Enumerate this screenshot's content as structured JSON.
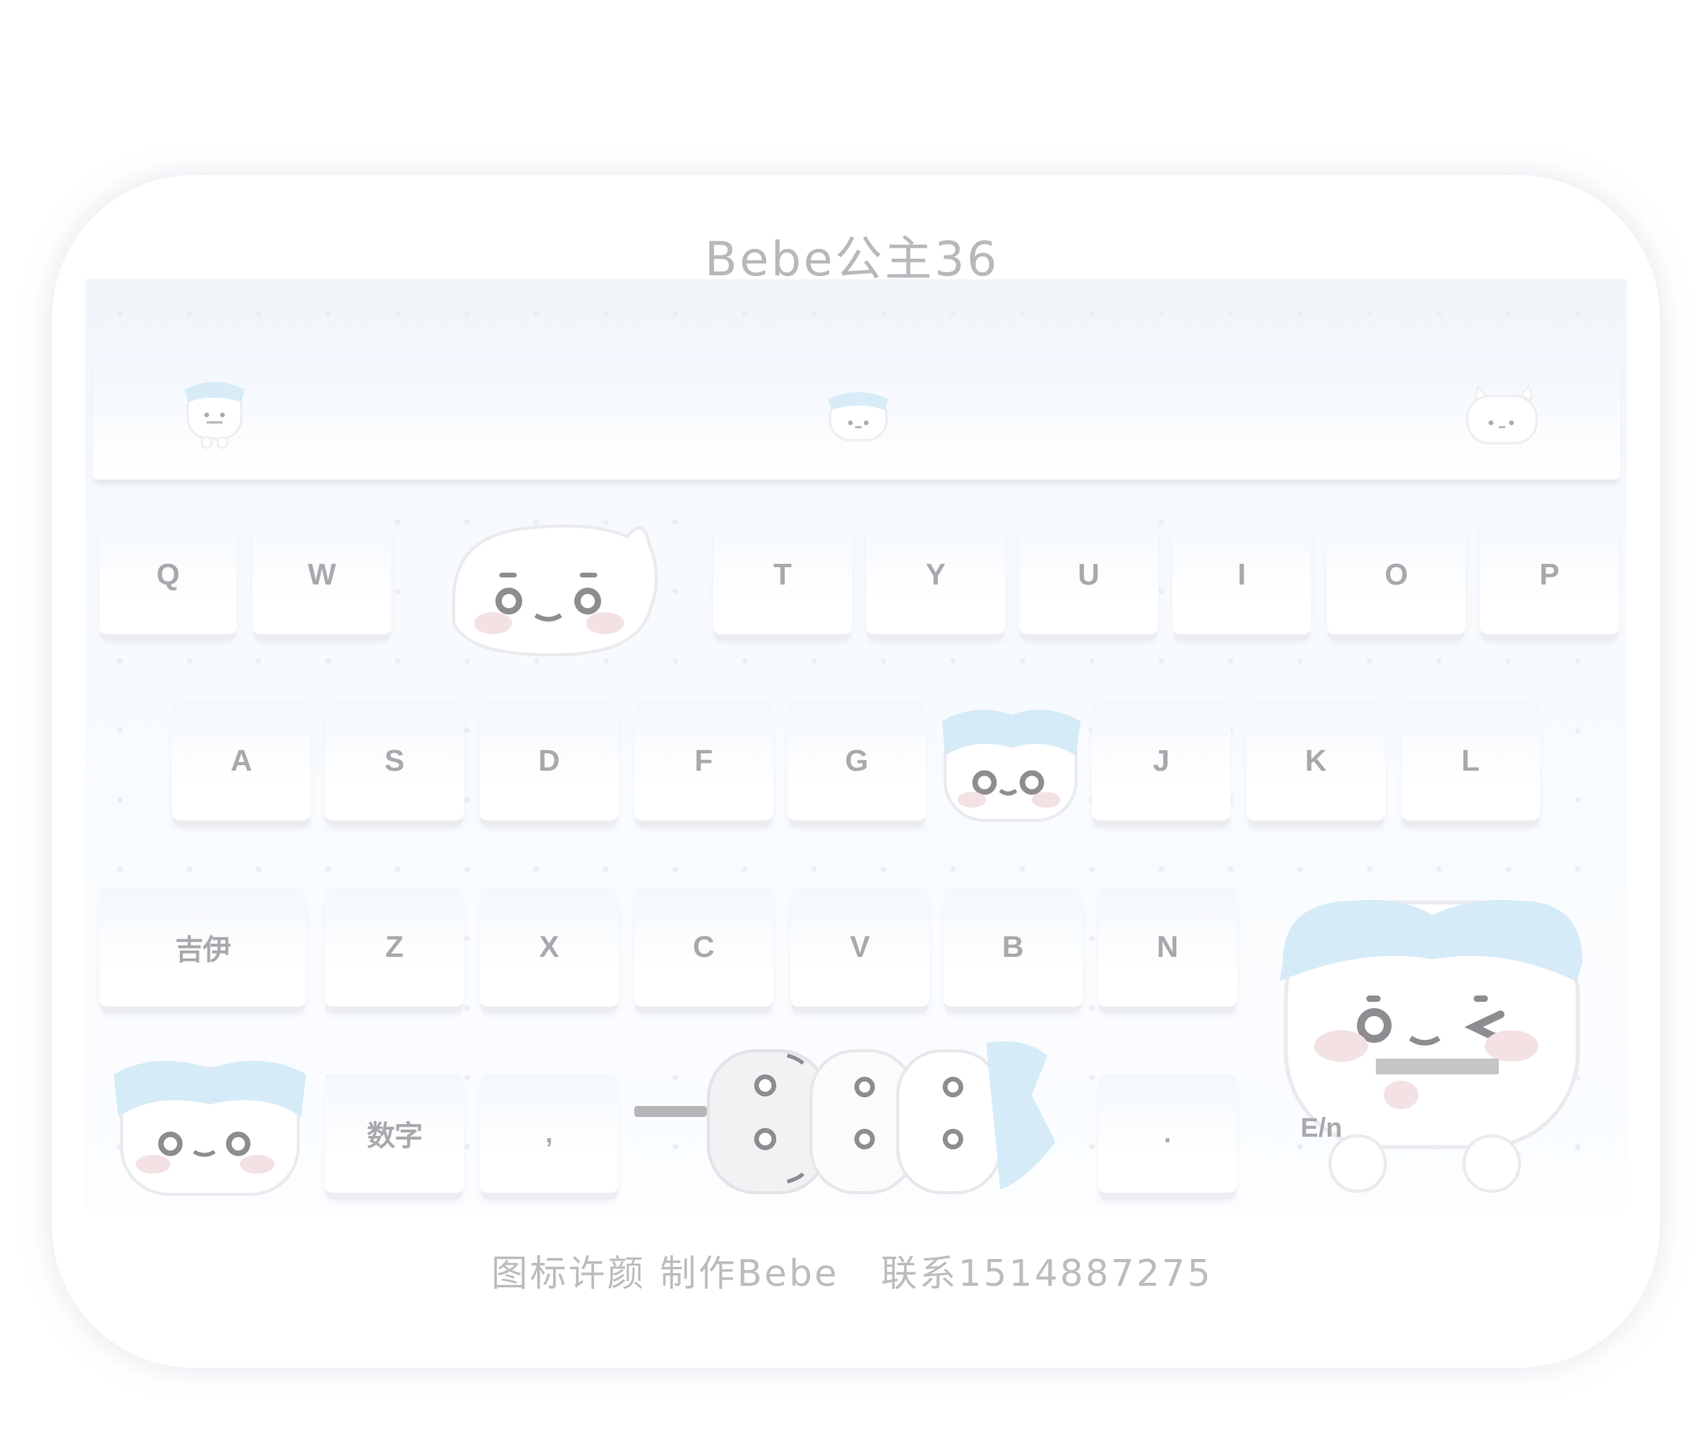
{
  "title": "Bebe公主36",
  "footer": "图标许颜 制作Bebe   联系1514887275",
  "keyboard": {
    "row1": [
      "Q",
      "W",
      "T",
      "Y",
      "U",
      "I",
      "O",
      "P"
    ],
    "row2": [
      "A",
      "S",
      "D",
      "F",
      "G",
      "J",
      "K",
      "L"
    ],
    "row3_special": "吉伊",
    "row3": [
      "Z",
      "X",
      "C",
      "V",
      "B",
      "N"
    ],
    "row4": {
      "numbers": "数字",
      "comma": ",",
      "period": ".",
      "lang": "E/n"
    }
  },
  "colors": {
    "key_text": "#aaa8ac",
    "accent_blue": "#d6ebf8",
    "blush": "#f4e3e5"
  }
}
